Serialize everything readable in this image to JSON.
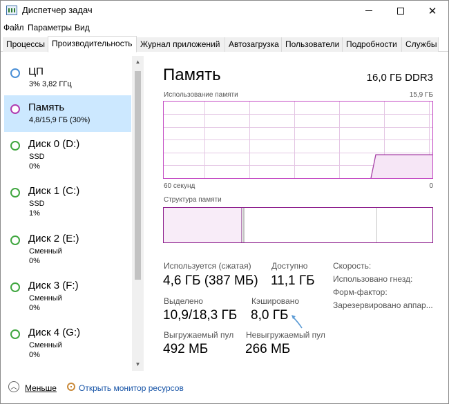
{
  "window": {
    "title": "Диспетчер задач",
    "min_icon": "minimize-icon",
    "max_icon": "maximize-icon",
    "close_symbol": "✕"
  },
  "menu": [
    "Файл",
    "Параметры",
    "Вид"
  ],
  "tabs": [
    {
      "label": "Процессы"
    },
    {
      "label": "Производительность",
      "active": true
    },
    {
      "label": "Журнал приложений"
    },
    {
      "label": "Автозагрузка"
    },
    {
      "label": "Пользователи"
    },
    {
      "label": "Подробности"
    },
    {
      "label": "Службы"
    }
  ],
  "sidebar": {
    "items": [
      {
        "name": "ЦП",
        "sub1": "3%  3,82 ГГц",
        "sub2": "",
        "color": "#4a8fd6"
      },
      {
        "name": "Память",
        "sub1": "4,8/15,9 ГБ (30%)",
        "sub2": "",
        "color": "#b03cb0",
        "selected": true
      },
      {
        "name": "Диск 0 (D:)",
        "sub1": "SSD",
        "sub2": "0%",
        "color": "#3fa63f"
      },
      {
        "name": "Диск 1 (C:)",
        "sub1": "SSD",
        "sub2": "1%",
        "color": "#3fa63f"
      },
      {
        "name": "Диск 2 (E:)",
        "sub1": "Сменный",
        "sub2": "0%",
        "color": "#3fa63f"
      },
      {
        "name": "Диск 3 (F:)",
        "sub1": "Сменный",
        "sub2": "0%",
        "color": "#3fa63f"
      },
      {
        "name": "Диск 4 (G:)",
        "sub1": "Сменный",
        "sub2": "0%",
        "color": "#3fa63f"
      }
    ]
  },
  "main": {
    "title": "Память",
    "total": "16,0 ГБ DDR3",
    "usage_label": "Использование памяти",
    "usage_max": "15,9 ГБ",
    "time_left": "60 секунд",
    "time_right": "0",
    "structure_label": "Структура памяти",
    "stats": {
      "in_use_label": "Используется (сжатая)",
      "in_use_value": "4,6 ГБ (387 МБ)",
      "available_label": "Доступно",
      "available_value": "11,1 ГБ",
      "committed_label": "Выделено",
      "committed_value": "10,9/18,3 ГБ",
      "cached_label": "Кэшировано",
      "cached_value": "8,0 ГБ",
      "paged_label": "Выгружаемый пул",
      "paged_value": "492 МБ",
      "nonpaged_label": "Невыгружаемый пул",
      "nonpaged_value": "266 МБ"
    },
    "right_labels": [
      "Скорость:",
      "Использовано гнезд:",
      "Форм-фактор:",
      "Зарезервировано аппар..."
    ]
  },
  "footer": {
    "less_label": "Меньше",
    "resmon_label": "Открыть монитор ресурсов"
  },
  "colors": {
    "memory_accent": "#b03cb0",
    "selected_bg": "#cce8ff",
    "link": "#1a56a8"
  }
}
